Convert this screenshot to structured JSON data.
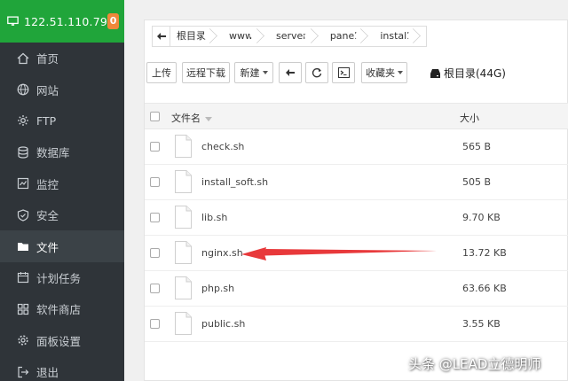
{
  "colors": {
    "sidebar_bg": "#2f3439",
    "header_bg": "#20a53a",
    "badge_bg": "#f0883a",
    "arrow": "#e8393b"
  },
  "sidebar": {
    "ip": "122.51.110.79",
    "badge": "0",
    "items": [
      {
        "label": "首页",
        "icon": "home-icon"
      },
      {
        "label": "网站",
        "icon": "globe-icon"
      },
      {
        "label": "FTP",
        "icon": "ftp-icon"
      },
      {
        "label": "数据库",
        "icon": "database-icon"
      },
      {
        "label": "监控",
        "icon": "monitor-icon"
      },
      {
        "label": "安全",
        "icon": "shield-icon"
      },
      {
        "label": "文件",
        "icon": "folder-icon",
        "active": true
      },
      {
        "label": "计划任务",
        "icon": "calendar-icon"
      },
      {
        "label": "软件商店",
        "icon": "apps-icon"
      },
      {
        "label": "面板设置",
        "icon": "gear-icon"
      },
      {
        "label": "退出",
        "icon": "logout-icon"
      }
    ]
  },
  "breadcrumb": [
    "根目录",
    "www",
    "server",
    "panel",
    "install"
  ],
  "toolbar": {
    "upload": "上传",
    "remote_download": "远程下载",
    "new": "新建",
    "favorites": "收藏夹",
    "disk": "根目录(44G)"
  },
  "table": {
    "col_name": "文件名",
    "col_size": "大小",
    "rows": [
      {
        "name": "check.sh",
        "size": "565 B"
      },
      {
        "name": "install_soft.sh",
        "size": "505 B"
      },
      {
        "name": "lib.sh",
        "size": "9.70 KB"
      },
      {
        "name": "nginx.sh",
        "size": "13.72 KB"
      },
      {
        "name": "php.sh",
        "size": "63.66 KB"
      },
      {
        "name": "public.sh",
        "size": "3.55 KB"
      }
    ]
  },
  "watermark": "头条 @LEAD立德明师"
}
